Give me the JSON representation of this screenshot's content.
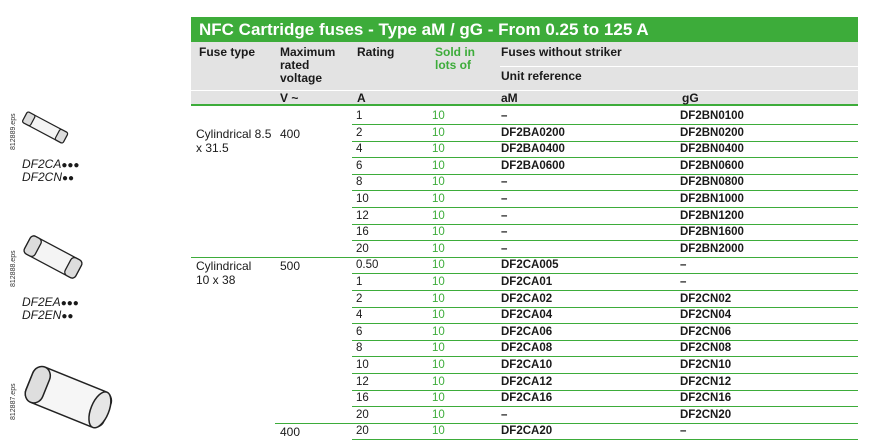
{
  "title": "NFC Cartridge fuses - Type aM / gG - From 0.25 to 125 A",
  "headers": {
    "fuse_type": "Fuse type",
    "max_voltage": "Maximum rated voltage",
    "rating": "Rating",
    "sold_in": "Sold in lots of",
    "without_striker": "Fuses without striker",
    "unit_reference": "Unit reference"
  },
  "units": {
    "voltage": "V ~",
    "rating": "A",
    "am": "aM",
    "gg": "gG"
  },
  "images": [
    {
      "eps": "812889.eps",
      "label1": "DF2CA",
      "dots1": "●●●",
      "label2": "DF2CN",
      "dots2": "●●"
    },
    {
      "eps": "812888.eps",
      "label1": "DF2EA",
      "dots1": "●●●",
      "label2": "DF2EN",
      "dots2": "●●"
    },
    {
      "eps": "812887.eps"
    }
  ],
  "groups": [
    {
      "fuse_type": "Cylindrical 8.5 x 31.5",
      "voltage": "400"
    },
    {
      "fuse_type": "Cylindrical 10 x 38",
      "voltage": "500"
    },
    {
      "fuse_type": "",
      "voltage": "400"
    }
  ],
  "rows": [
    {
      "rating": "1",
      "lot": "10",
      "am": "–",
      "gg": "DF2BN0100"
    },
    {
      "rating": "2",
      "lot": "10",
      "am": "DF2BA0200",
      "gg": "DF2BN0200"
    },
    {
      "rating": "4",
      "lot": "10",
      "am": "DF2BA0400",
      "gg": "DF2BN0400"
    },
    {
      "rating": "6",
      "lot": "10",
      "am": "DF2BA0600",
      "gg": "DF2BN0600"
    },
    {
      "rating": "8",
      "lot": "10",
      "am": "–",
      "gg": "DF2BN0800"
    },
    {
      "rating": "10",
      "lot": "10",
      "am": "–",
      "gg": "DF2BN1000"
    },
    {
      "rating": "12",
      "lot": "10",
      "am": "–",
      "gg": "DF2BN1200"
    },
    {
      "rating": "16",
      "lot": "10",
      "am": "–",
      "gg": "DF2BN1600"
    },
    {
      "rating": "20",
      "lot": "10",
      "am": "–",
      "gg": "DF2BN2000"
    },
    {
      "rating": "0.50",
      "lot": "10",
      "am": "DF2CA005",
      "gg": "–"
    },
    {
      "rating": "1",
      "lot": "10",
      "am": "DF2CA01",
      "gg": "–"
    },
    {
      "rating": "2",
      "lot": "10",
      "am": "DF2CA02",
      "gg": "DF2CN02"
    },
    {
      "rating": "4",
      "lot": "10",
      "am": "DF2CA04",
      "gg": "DF2CN04"
    },
    {
      "rating": "6",
      "lot": "10",
      "am": "DF2CA06",
      "gg": "DF2CN06"
    },
    {
      "rating": "8",
      "lot": "10",
      "am": "DF2CA08",
      "gg": "DF2CN08"
    },
    {
      "rating": "10",
      "lot": "10",
      "am": "DF2CA10",
      "gg": "DF2CN10"
    },
    {
      "rating": "12",
      "lot": "10",
      "am": "DF2CA12",
      "gg": "DF2CN12"
    },
    {
      "rating": "16",
      "lot": "10",
      "am": "DF2CA16",
      "gg": "DF2CN16"
    },
    {
      "rating": "20",
      "lot": "10",
      "am": "–",
      "gg": "DF2CN20"
    },
    {
      "rating": "20",
      "lot": "10",
      "am": "DF2CA20",
      "gg": "–"
    }
  ]
}
